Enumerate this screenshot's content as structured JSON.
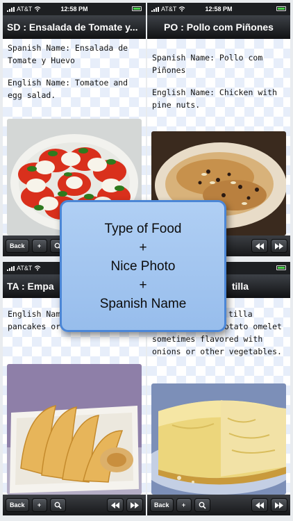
{
  "statusbar": {
    "carrier": "AT&T",
    "time": "12:58 PM"
  },
  "panels": [
    {
      "title": "SD : Ensalada de Tomate y...",
      "spanish": "Spanish Name: Ensalada de Tomate y Huevo",
      "english": "English Name: Tomatoe and egg salad.",
      "photo": "tomato-egg-salad"
    },
    {
      "title": "PO : Pollo com Piñones",
      "spanish": "Spanish Name: Pollo com Piñones",
      "english": "English Name: Chicken with pine nuts.",
      "photo": "chicken-pine-nuts"
    },
    {
      "title": "TA : Empa",
      "spanish": "English Name",
      "english": "pancakes or p",
      "photo": "empanadas"
    },
    {
      "title": "tilla",
      "spanish": "tilla",
      "english": "English Name: Potato omelet sometimes flavored with onions or other vegetables.",
      "photo": "tortilla"
    }
  ],
  "toolbar": {
    "back": "Back",
    "add": "+",
    "search_icon": "search-icon",
    "prev_icon": "rewind-icon",
    "next_icon": "fast-forward-icon"
  },
  "overlay": {
    "line1": "Type of Food",
    "plus1": "+",
    "line2": "Nice Photo",
    "plus2": "+",
    "line3": "Spanish Name"
  },
  "colors": {
    "overlay_bg": "#a8c9f2",
    "overlay_border": "#4b86d6",
    "bar_dark": "#17181a"
  }
}
